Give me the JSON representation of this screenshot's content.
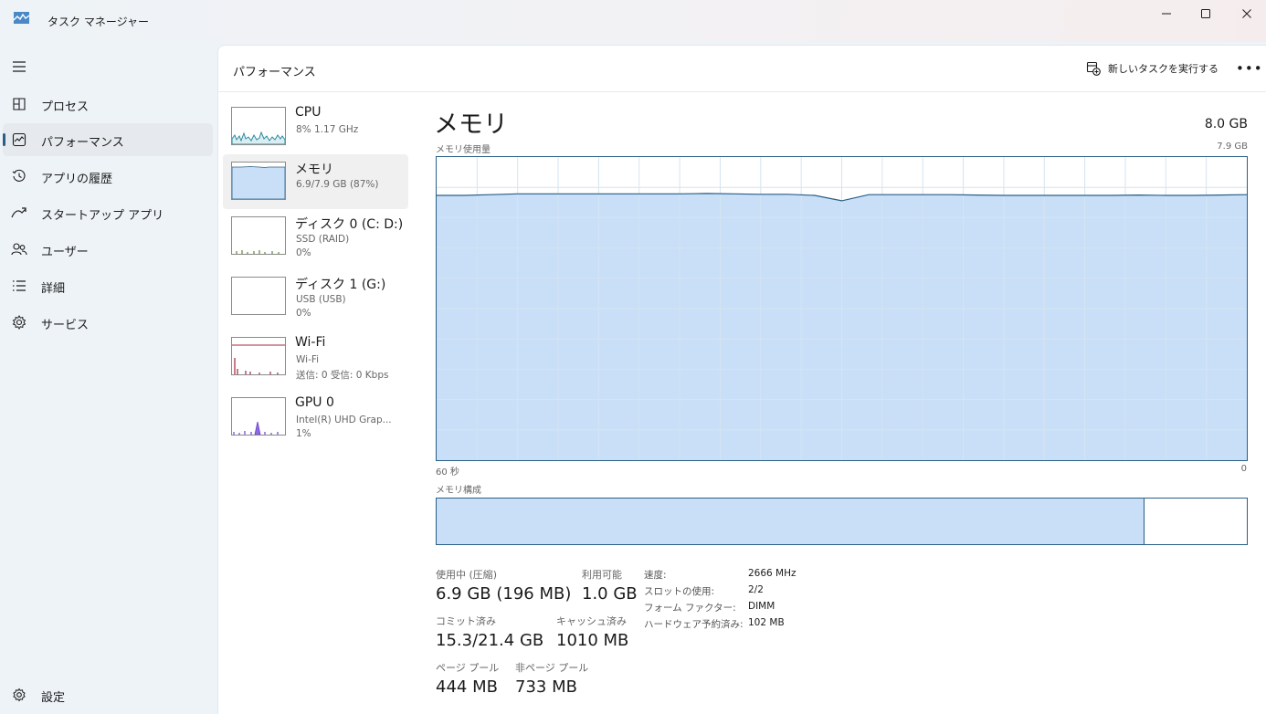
{
  "window": {
    "title": "タスク マネージャー",
    "minimize_icon": "minimize-icon",
    "maximize_icon": "maximize-icon",
    "close_icon": "close-icon"
  },
  "sidebar": {
    "items": [
      {
        "label": "プロセス",
        "icon": "processes-icon"
      },
      {
        "label": "パフォーマンス",
        "icon": "performance-icon",
        "active": true
      },
      {
        "label": "アプリの履歴",
        "icon": "history-icon"
      },
      {
        "label": "スタートアップ アプリ",
        "icon": "startup-icon"
      },
      {
        "label": "ユーザー",
        "icon": "users-icon"
      },
      {
        "label": "詳細",
        "icon": "details-icon"
      },
      {
        "label": "サービス",
        "icon": "services-icon"
      }
    ],
    "settings_label": "設定"
  },
  "header": {
    "title": "パフォーマンス",
    "run_task_label": "新しいタスクを実行する",
    "more_label": "•••"
  },
  "devices": [
    {
      "name": "CPU",
      "line1": "8%  1.17 GHz",
      "line2": ""
    },
    {
      "name": "メモリ",
      "line1": "6.9/7.9 GB (87%)",
      "line2": "",
      "active": true
    },
    {
      "name": "ディスク 0 (C: D:)",
      "line1": "SSD (RAID)",
      "line2": "0%"
    },
    {
      "name": "ディスク 1 (G:)",
      "line1": "USB (USB)",
      "line2": "0%"
    },
    {
      "name": "Wi-Fi",
      "line1": "Wi-Fi",
      "line2": "送信: 0 受信: 0 Kbps"
    },
    {
      "name": "GPU 0",
      "line1": "Intel(R) UHD Grap...",
      "line2": "1%"
    }
  ],
  "memory": {
    "title": "メモリ",
    "total": "8.0 GB",
    "usage_label": "メモリ使用量",
    "usage_max": "7.9 GB",
    "axis_left": "60 秒",
    "axis_right": "0",
    "composition_label": "メモリ構成",
    "composition_used_fraction": 0.874,
    "colors": {
      "fill": "#c8dff7",
      "line": "#2a5f86",
      "grid": "#d5e4f1"
    },
    "stats": {
      "in_use_label": "使用中 (圧縮)",
      "in_use_value": "6.9 GB (196 MB)",
      "available_label": "利用可能",
      "available_value": "1.0 GB",
      "committed_label": "コミット済み",
      "committed_value": "15.3/21.4 GB",
      "cached_label": "キャッシュ済み",
      "cached_value": "1010 MB",
      "paged_label": "ページ プール",
      "paged_value": "444 MB",
      "nonpaged_label": "非ページ プール",
      "nonpaged_value": "733 MB"
    },
    "details": [
      {
        "key": "速度:",
        "value": "2666 MHz"
      },
      {
        "key": "スロットの使用:",
        "value": "2/2"
      },
      {
        "key": "フォーム ファクター:",
        "value": "DIMM"
      },
      {
        "key": "ハードウェア予約済み:",
        "value": "102 MB"
      }
    ]
  },
  "chart_data": {
    "type": "area",
    "title": "メモリ使用量",
    "x": [
      60,
      58,
      56,
      54,
      52,
      50,
      48,
      46,
      44,
      42,
      40,
      38,
      36,
      34,
      32,
      30,
      28,
      26,
      24,
      22,
      20,
      18,
      16,
      14,
      12,
      10,
      8,
      6,
      4,
      2,
      0
    ],
    "xlim": [
      60,
      0
    ],
    "ylim": [
      0,
      7.9
    ],
    "series": [
      {
        "values": [
          6.9,
          6.9,
          6.92,
          6.94,
          6.94,
          6.94,
          6.94,
          6.94,
          6.94,
          6.94,
          6.95,
          6.94,
          6.93,
          6.93,
          6.9,
          6.76,
          6.92,
          6.92,
          6.92,
          6.92,
          6.91,
          6.9,
          6.9,
          6.9,
          6.9,
          6.9,
          6.91,
          6.9,
          6.9,
          6.91,
          6.92
        ]
      }
    ],
    "grid": true
  }
}
